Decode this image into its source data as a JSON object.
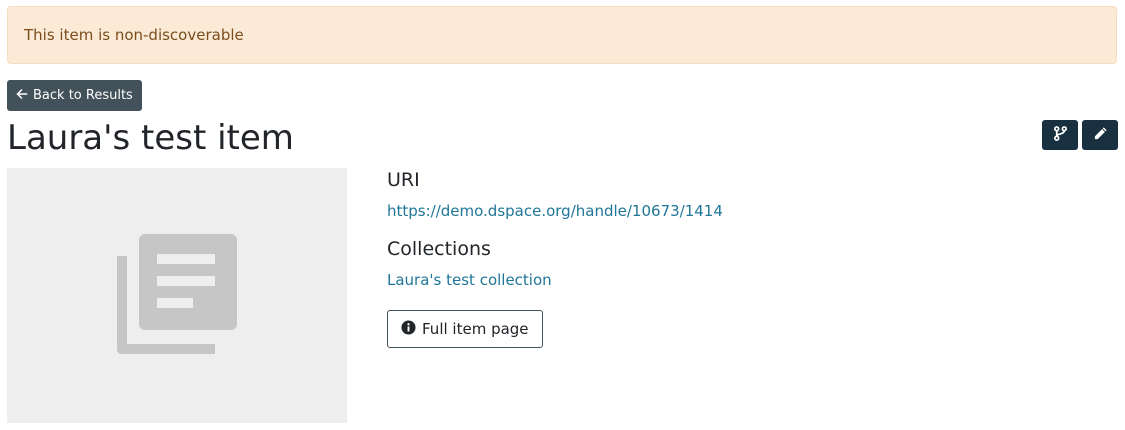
{
  "alert": {
    "text": "This item is non-discoverable"
  },
  "back_button": {
    "label": "Back to Results",
    "icon": "arrow-left-icon"
  },
  "item": {
    "title": "Laura's test item"
  },
  "actions": [
    {
      "name": "version-button",
      "icon": "code-branch-icon"
    },
    {
      "name": "edit-button",
      "icon": "pencil-icon"
    }
  ],
  "thumbnail": {
    "icon": "library-books-icon"
  },
  "metadata": {
    "uri": {
      "label": "URI",
      "value": "https://demo.dspace.org/handle/10673/1414"
    },
    "collections": {
      "label": "Collections",
      "value": "Laura's test collection"
    }
  },
  "full_item_button": {
    "label": "Full item page",
    "icon": "info-circle-icon"
  },
  "colors": {
    "alert_bg": "#fbead6",
    "alert_text": "#7a4e1d",
    "dark_button": "#43515b",
    "navy_button": "#18303f",
    "link": "#207698",
    "thumbnail_bg": "#efeeee"
  }
}
